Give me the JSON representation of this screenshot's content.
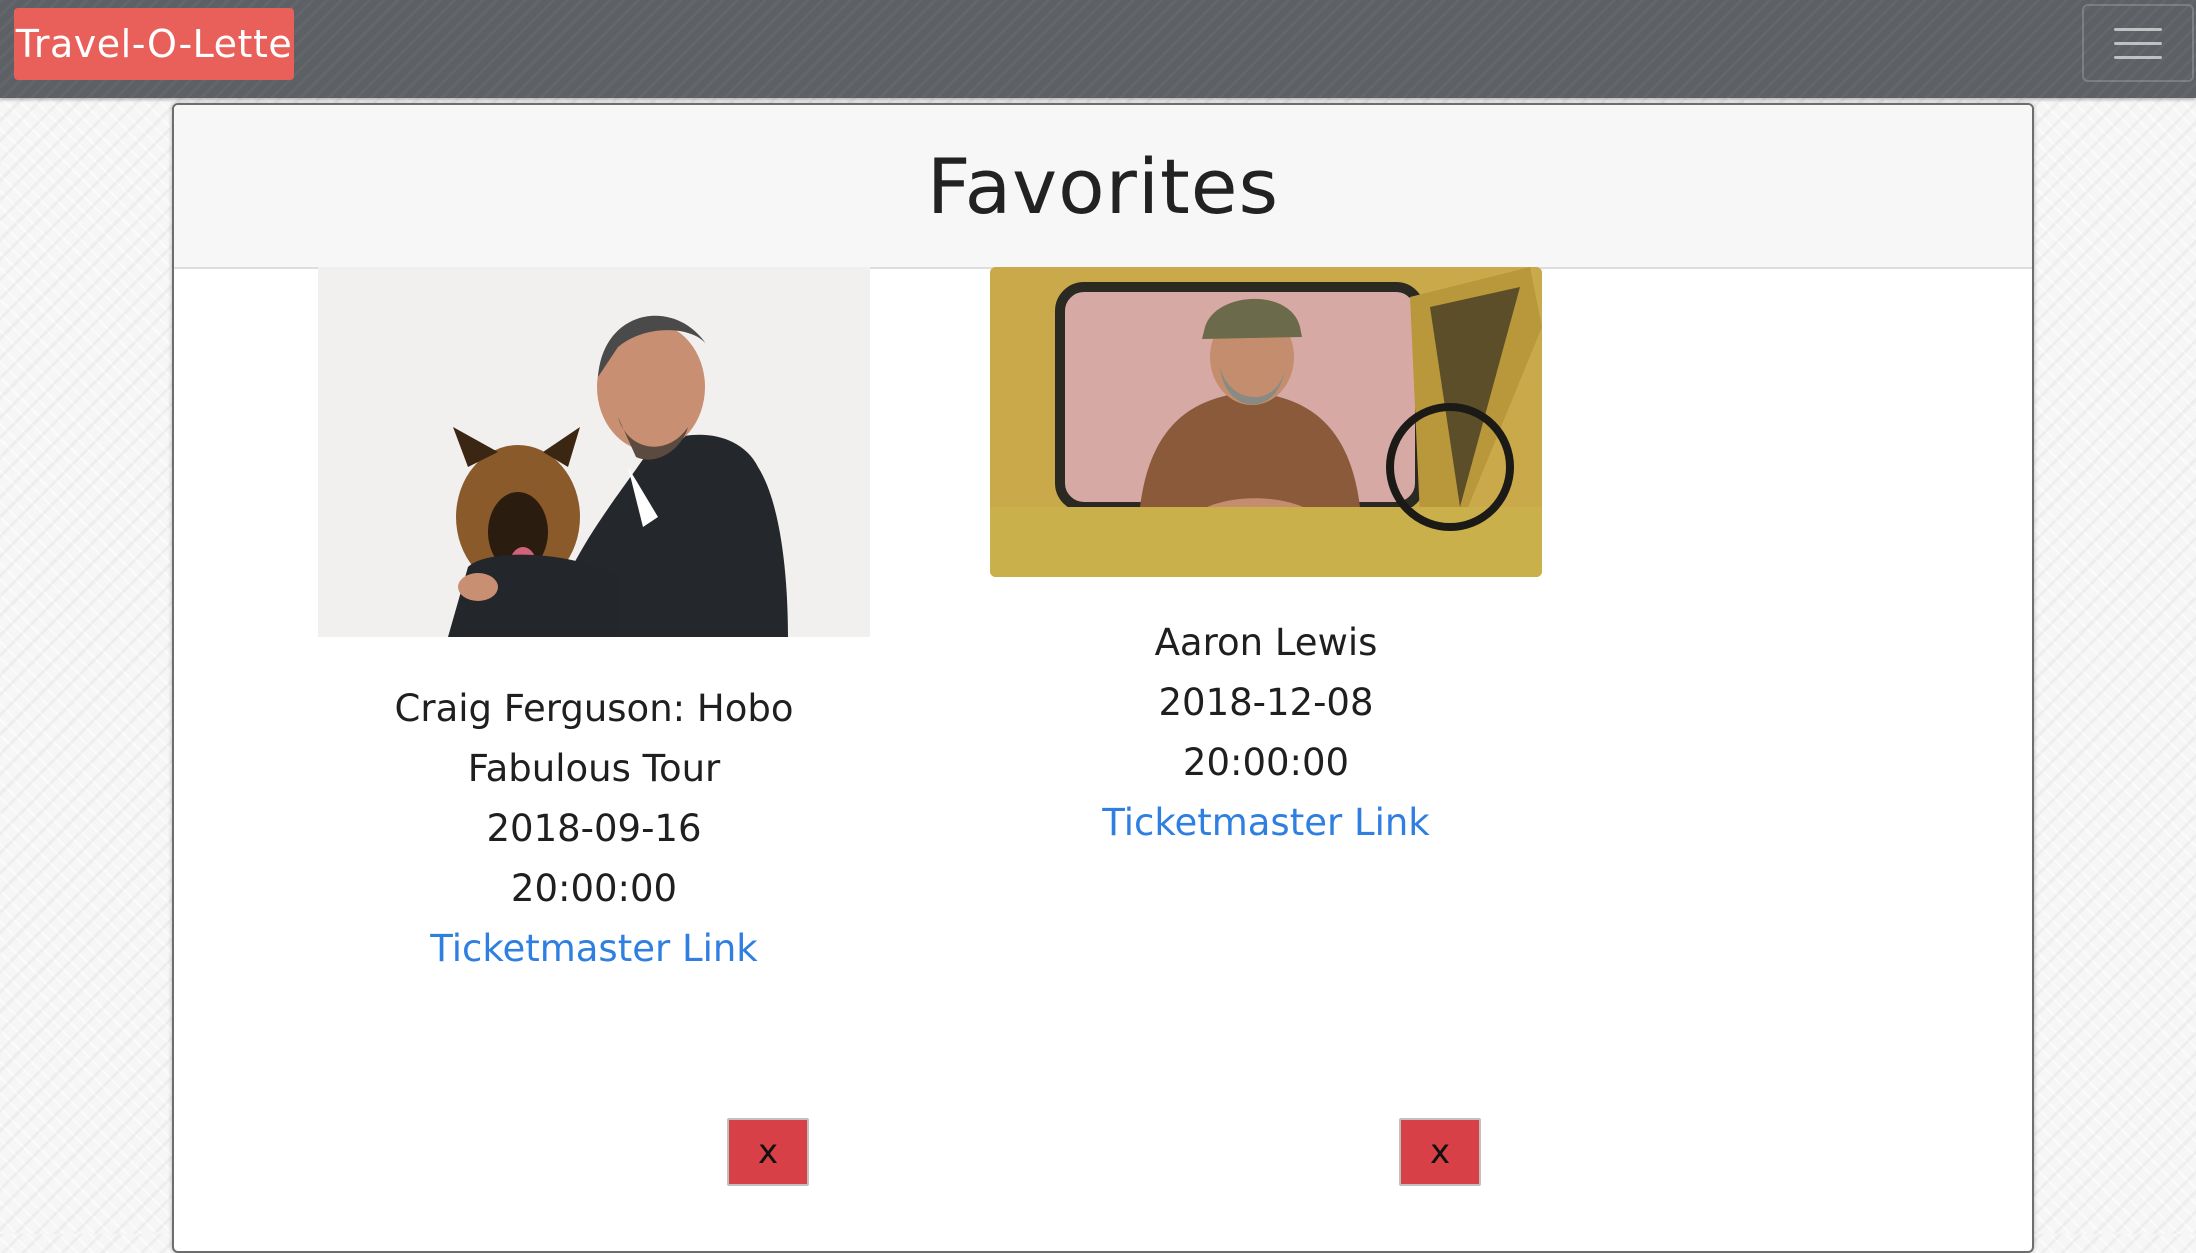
{
  "navbar": {
    "brand": "Travel-O-Lette",
    "menu_icon": "hamburger-menu-icon"
  },
  "colors": {
    "brand_bg": "#e9605b",
    "navbar_bg": "#5d6166",
    "link": "#2f7fe0",
    "remove_button": "#d64046"
  },
  "page": {
    "title": "Favorites"
  },
  "favorites": [
    {
      "name": "Craig Ferguson: Hobo Fabulous Tour",
      "date": "2018-09-16",
      "time": "20:00:00",
      "link_label": "Ticketmaster Link",
      "remove_label": "x"
    },
    {
      "name": "Aaron Lewis",
      "date": "2018-12-08",
      "time": "20:00:00",
      "link_label": "Ticketmaster Link",
      "remove_label": "x"
    }
  ]
}
